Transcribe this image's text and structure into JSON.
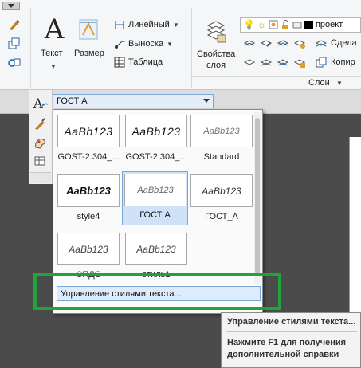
{
  "ribbon": {
    "text_button": "Текст",
    "size_button": "Размер",
    "linear_button": "Линейный",
    "leader_button": "Выноска",
    "table_button": "Таблица",
    "layer_props_line1": "Свойства",
    "layer_props_line2": "слоя",
    "layer_name": "проект",
    "make_current": "Сдела",
    "copy": "Копир",
    "layers_panel": "Слои"
  },
  "text_style_combo": {
    "value": "ГОСТ А"
  },
  "gallery": {
    "styles": [
      {
        "name": "GOST-2.304_...",
        "preview": "AaBb123"
      },
      {
        "name": "GOST-2.304_...",
        "preview": "AaBb123"
      },
      {
        "name": "Standard",
        "preview": "AaBb123"
      },
      {
        "name": "style4",
        "preview": "AaBb123"
      },
      {
        "name": "ГОСТ А",
        "preview": "AaBb123"
      },
      {
        "name": "ГОСТ_А",
        "preview": "AaBb123"
      },
      {
        "name": "СПДС",
        "preview": "AaBb123"
      },
      {
        "name": "стиль1",
        "preview": "AaBb123"
      }
    ],
    "selected": "ГОСТ А",
    "manage_label": "Управление стилями текста..."
  },
  "tooltip": {
    "title": "Управление стилями текста...",
    "help": "Нажмите F1 для получения дополнительной справки"
  },
  "colors": {
    "highlight": "#22a33a",
    "selection": "#cfe2f7",
    "accent": "#7aa7da"
  }
}
